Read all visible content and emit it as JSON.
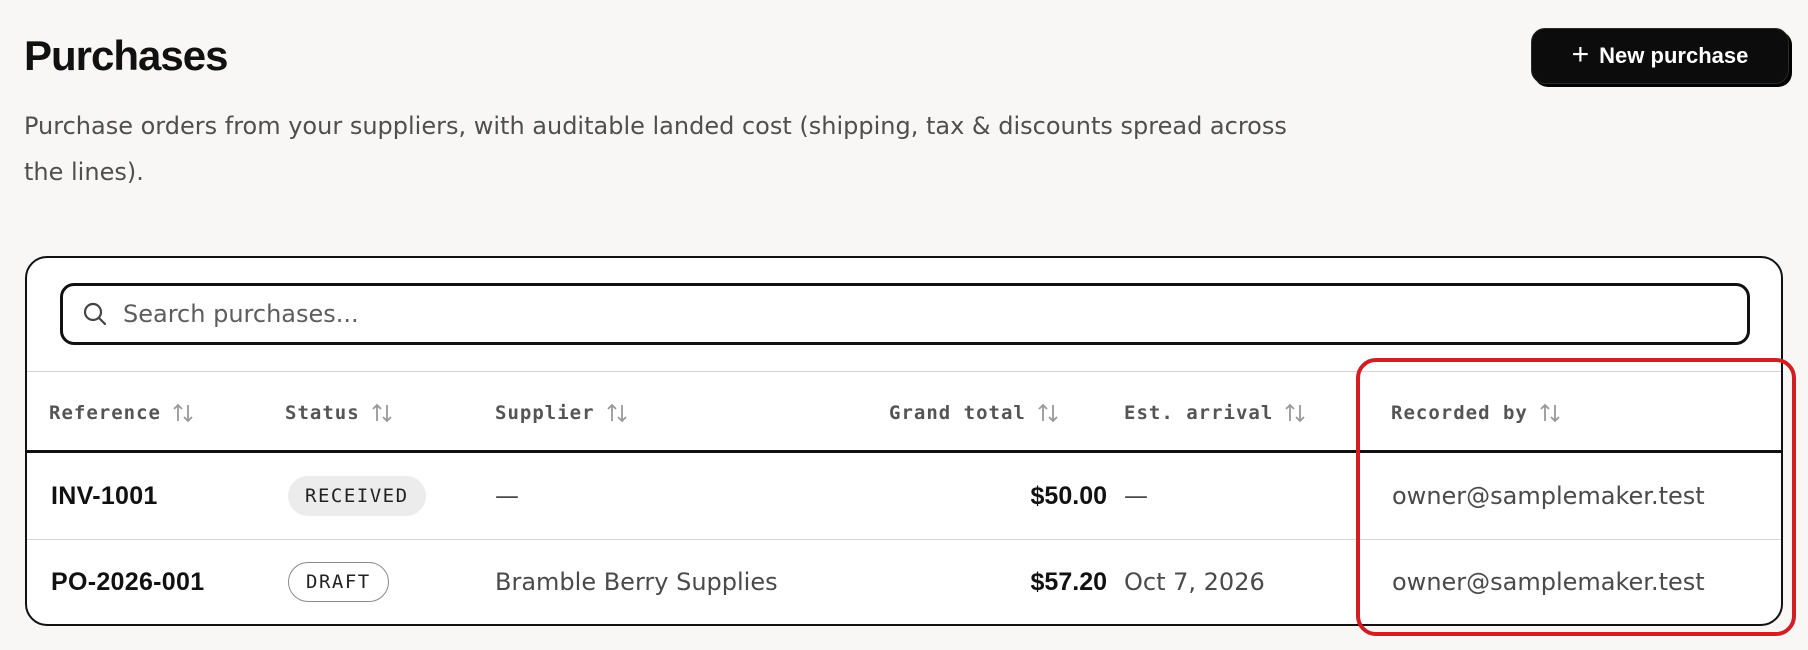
{
  "page": {
    "title": "Purchases",
    "description": "Purchase orders from your suppliers, with auditable landed cost (shipping, tax & discounts spread across the lines).",
    "new_button": {
      "icon": "plus-icon",
      "label": "New purchase"
    }
  },
  "search": {
    "icon": "search-icon",
    "placeholder": "Search purchases..."
  },
  "table": {
    "columns": [
      {
        "label": "Reference",
        "sort_icon": "sort-icon"
      },
      {
        "label": "Status",
        "sort_icon": "sort-icon"
      },
      {
        "label": "Supplier",
        "sort_icon": "sort-icon"
      },
      {
        "label": "Grand total",
        "sort_icon": "sort-icon"
      },
      {
        "label": "Est. arrival",
        "sort_icon": "sort-icon"
      },
      {
        "label": "Recorded by",
        "sort_icon": "sort-icon"
      }
    ],
    "rows": [
      {
        "reference": "INV-1001",
        "status": "RECEIVED",
        "supplier": "—",
        "grand_total": "$50.00",
        "est_arrival": "—",
        "recorded_by": "owner@samplemaker.test"
      },
      {
        "reference": "PO-2026-001",
        "status": "DRAFT",
        "supplier": "Bramble Berry Supplies",
        "grand_total": "$57.20",
        "est_arrival": "Oct 7, 2026",
        "recorded_by": "owner@samplemaker.test"
      }
    ]
  },
  "colors": {
    "background": "#f8f7f5",
    "primary_button": "#0c0c0c",
    "highlight": "#d21e22",
    "badge_received_bg": "#ececec"
  }
}
